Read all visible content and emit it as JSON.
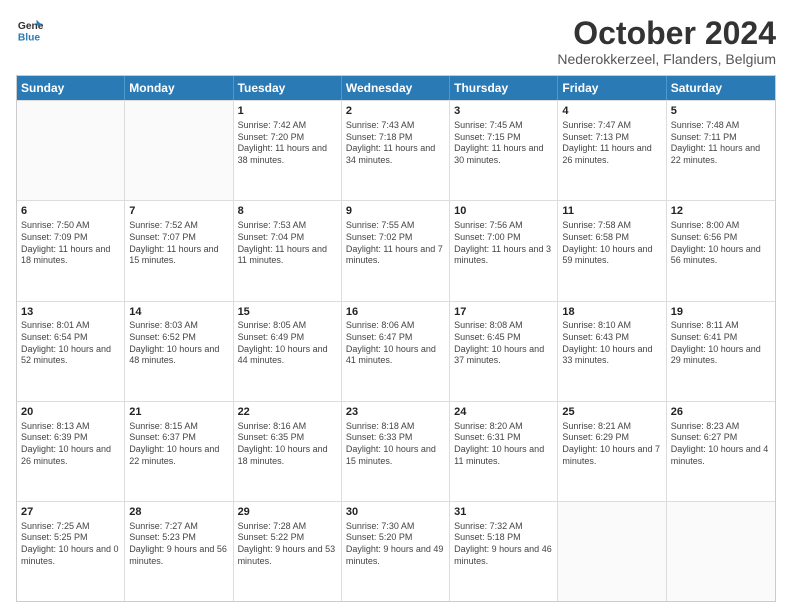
{
  "header": {
    "logo_line1": "General",
    "logo_line2": "Blue",
    "month": "October 2024",
    "location": "Nederokkerzeel, Flanders, Belgium"
  },
  "days_of_week": [
    "Sunday",
    "Monday",
    "Tuesday",
    "Wednesday",
    "Thursday",
    "Friday",
    "Saturday"
  ],
  "rows": [
    [
      {
        "day": "",
        "sunrise": "",
        "sunset": "",
        "daylight": ""
      },
      {
        "day": "",
        "sunrise": "",
        "sunset": "",
        "daylight": ""
      },
      {
        "day": "1",
        "sunrise": "Sunrise: 7:42 AM",
        "sunset": "Sunset: 7:20 PM",
        "daylight": "Daylight: 11 hours and 38 minutes."
      },
      {
        "day": "2",
        "sunrise": "Sunrise: 7:43 AM",
        "sunset": "Sunset: 7:18 PM",
        "daylight": "Daylight: 11 hours and 34 minutes."
      },
      {
        "day": "3",
        "sunrise": "Sunrise: 7:45 AM",
        "sunset": "Sunset: 7:15 PM",
        "daylight": "Daylight: 11 hours and 30 minutes."
      },
      {
        "day": "4",
        "sunrise": "Sunrise: 7:47 AM",
        "sunset": "Sunset: 7:13 PM",
        "daylight": "Daylight: 11 hours and 26 minutes."
      },
      {
        "day": "5",
        "sunrise": "Sunrise: 7:48 AM",
        "sunset": "Sunset: 7:11 PM",
        "daylight": "Daylight: 11 hours and 22 minutes."
      }
    ],
    [
      {
        "day": "6",
        "sunrise": "Sunrise: 7:50 AM",
        "sunset": "Sunset: 7:09 PM",
        "daylight": "Daylight: 11 hours and 18 minutes."
      },
      {
        "day": "7",
        "sunrise": "Sunrise: 7:52 AM",
        "sunset": "Sunset: 7:07 PM",
        "daylight": "Daylight: 11 hours and 15 minutes."
      },
      {
        "day": "8",
        "sunrise": "Sunrise: 7:53 AM",
        "sunset": "Sunset: 7:04 PM",
        "daylight": "Daylight: 11 hours and 11 minutes."
      },
      {
        "day": "9",
        "sunrise": "Sunrise: 7:55 AM",
        "sunset": "Sunset: 7:02 PM",
        "daylight": "Daylight: 11 hours and 7 minutes."
      },
      {
        "day": "10",
        "sunrise": "Sunrise: 7:56 AM",
        "sunset": "Sunset: 7:00 PM",
        "daylight": "Daylight: 11 hours and 3 minutes."
      },
      {
        "day": "11",
        "sunrise": "Sunrise: 7:58 AM",
        "sunset": "Sunset: 6:58 PM",
        "daylight": "Daylight: 10 hours and 59 minutes."
      },
      {
        "day": "12",
        "sunrise": "Sunrise: 8:00 AM",
        "sunset": "Sunset: 6:56 PM",
        "daylight": "Daylight: 10 hours and 56 minutes."
      }
    ],
    [
      {
        "day": "13",
        "sunrise": "Sunrise: 8:01 AM",
        "sunset": "Sunset: 6:54 PM",
        "daylight": "Daylight: 10 hours and 52 minutes."
      },
      {
        "day": "14",
        "sunrise": "Sunrise: 8:03 AM",
        "sunset": "Sunset: 6:52 PM",
        "daylight": "Daylight: 10 hours and 48 minutes."
      },
      {
        "day": "15",
        "sunrise": "Sunrise: 8:05 AM",
        "sunset": "Sunset: 6:49 PM",
        "daylight": "Daylight: 10 hours and 44 minutes."
      },
      {
        "day": "16",
        "sunrise": "Sunrise: 8:06 AM",
        "sunset": "Sunset: 6:47 PM",
        "daylight": "Daylight: 10 hours and 41 minutes."
      },
      {
        "day": "17",
        "sunrise": "Sunrise: 8:08 AM",
        "sunset": "Sunset: 6:45 PM",
        "daylight": "Daylight: 10 hours and 37 minutes."
      },
      {
        "day": "18",
        "sunrise": "Sunrise: 8:10 AM",
        "sunset": "Sunset: 6:43 PM",
        "daylight": "Daylight: 10 hours and 33 minutes."
      },
      {
        "day": "19",
        "sunrise": "Sunrise: 8:11 AM",
        "sunset": "Sunset: 6:41 PM",
        "daylight": "Daylight: 10 hours and 29 minutes."
      }
    ],
    [
      {
        "day": "20",
        "sunrise": "Sunrise: 8:13 AM",
        "sunset": "Sunset: 6:39 PM",
        "daylight": "Daylight: 10 hours and 26 minutes."
      },
      {
        "day": "21",
        "sunrise": "Sunrise: 8:15 AM",
        "sunset": "Sunset: 6:37 PM",
        "daylight": "Daylight: 10 hours and 22 minutes."
      },
      {
        "day": "22",
        "sunrise": "Sunrise: 8:16 AM",
        "sunset": "Sunset: 6:35 PM",
        "daylight": "Daylight: 10 hours and 18 minutes."
      },
      {
        "day": "23",
        "sunrise": "Sunrise: 8:18 AM",
        "sunset": "Sunset: 6:33 PM",
        "daylight": "Daylight: 10 hours and 15 minutes."
      },
      {
        "day": "24",
        "sunrise": "Sunrise: 8:20 AM",
        "sunset": "Sunset: 6:31 PM",
        "daylight": "Daylight: 10 hours and 11 minutes."
      },
      {
        "day": "25",
        "sunrise": "Sunrise: 8:21 AM",
        "sunset": "Sunset: 6:29 PM",
        "daylight": "Daylight: 10 hours and 7 minutes."
      },
      {
        "day": "26",
        "sunrise": "Sunrise: 8:23 AM",
        "sunset": "Sunset: 6:27 PM",
        "daylight": "Daylight: 10 hours and 4 minutes."
      }
    ],
    [
      {
        "day": "27",
        "sunrise": "Sunrise: 7:25 AM",
        "sunset": "Sunset: 5:25 PM",
        "daylight": "Daylight: 10 hours and 0 minutes."
      },
      {
        "day": "28",
        "sunrise": "Sunrise: 7:27 AM",
        "sunset": "Sunset: 5:23 PM",
        "daylight": "Daylight: 9 hours and 56 minutes."
      },
      {
        "day": "29",
        "sunrise": "Sunrise: 7:28 AM",
        "sunset": "Sunset: 5:22 PM",
        "daylight": "Daylight: 9 hours and 53 minutes."
      },
      {
        "day": "30",
        "sunrise": "Sunrise: 7:30 AM",
        "sunset": "Sunset: 5:20 PM",
        "daylight": "Daylight: 9 hours and 49 minutes."
      },
      {
        "day": "31",
        "sunrise": "Sunrise: 7:32 AM",
        "sunset": "Sunset: 5:18 PM",
        "daylight": "Daylight: 9 hours and 46 minutes."
      },
      {
        "day": "",
        "sunrise": "",
        "sunset": "",
        "daylight": ""
      },
      {
        "day": "",
        "sunrise": "",
        "sunset": "",
        "daylight": ""
      }
    ]
  ]
}
